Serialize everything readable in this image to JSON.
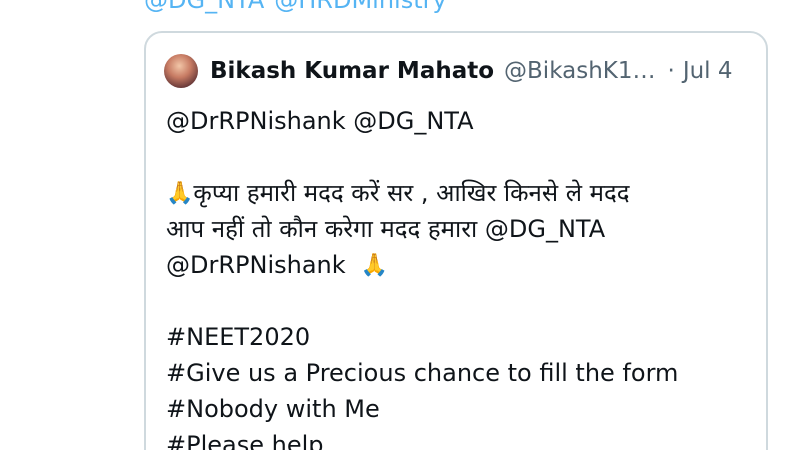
{
  "top_mentions": [
    "@DG_NTA",
    "@HRDMinistry"
  ],
  "quote": {
    "display_name": "Bikash Kumar Mahato",
    "handle": "@BikashK1…",
    "separator": "·",
    "date": "Jul 4",
    "avatar_icon": "profile-avatar",
    "lines": {
      "mentions": "@DrRPNishank @DG_NTA",
      "hindi_1": "कृप्या हमारी मदद करें सर , आखिर किनसे ले मदद",
      "hindi_2": "आप नहीं तो कौन करेगा मदद हमारा @DG_NTA",
      "hindi_3": "@DrRPNishank",
      "hashtag_1": "#NEET2020",
      "hashtag_2": "#Give us a Precious chance to fill the form",
      "hashtag_3": "#Nobody with Me",
      "hashtag_4": "#Please help"
    },
    "emoji": "🙏"
  }
}
